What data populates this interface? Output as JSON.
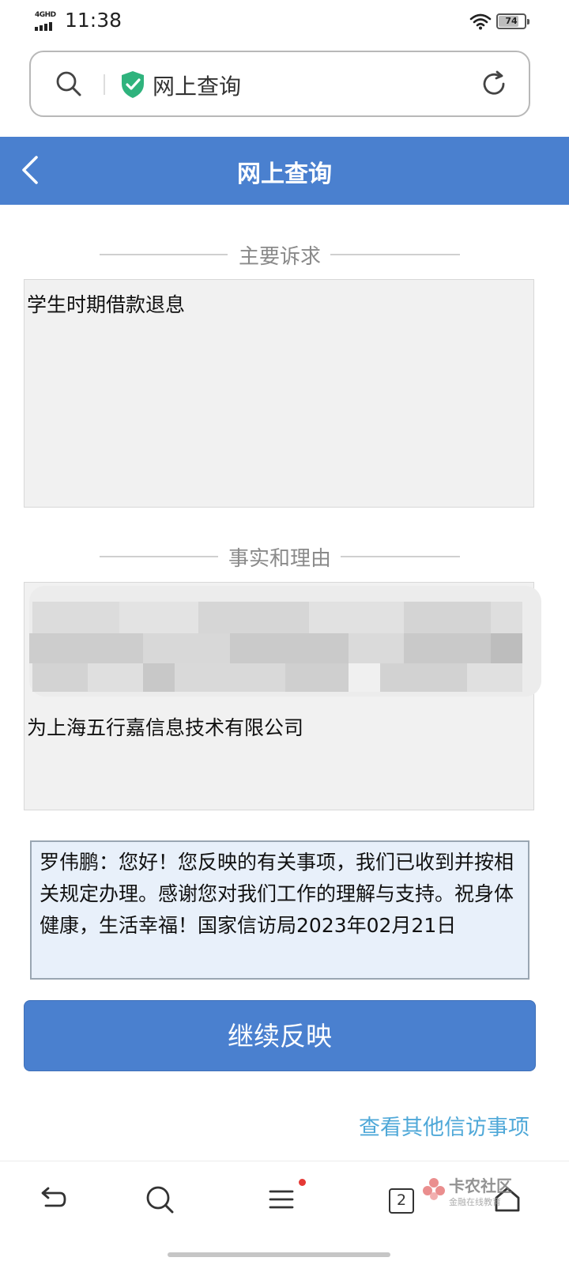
{
  "status_bar": {
    "network": "4GHD",
    "time": "11:38",
    "battery": "74"
  },
  "address_bar": {
    "url_text": "网上查询"
  },
  "header": {
    "title": "网上查询"
  },
  "sections": {
    "main_appeal": {
      "label": "主要诉求",
      "content": "学生时期借款退息"
    },
    "facts": {
      "label": "事实和理由",
      "content": "为上海五行嘉信息技术有限公司"
    }
  },
  "reply": {
    "text": "罗伟鹏：您好！您反映的有关事项，我们已收到并按相关规定办理。感谢您对我们工作的理解与支持。祝身体健康，生活幸福！国家信访局2023年02月21日"
  },
  "continue_button": {
    "label": "继续反映"
  },
  "other_link": {
    "label": "查看其他信访事项"
  },
  "bottom_nav": {
    "tab_count": "2"
  },
  "watermark": {
    "title": "卡农社区",
    "subtitle": "金融在线教育"
  },
  "colors": {
    "primary": "#4a80cf",
    "link": "#4fa8d8",
    "shield": "#2fb37d"
  }
}
